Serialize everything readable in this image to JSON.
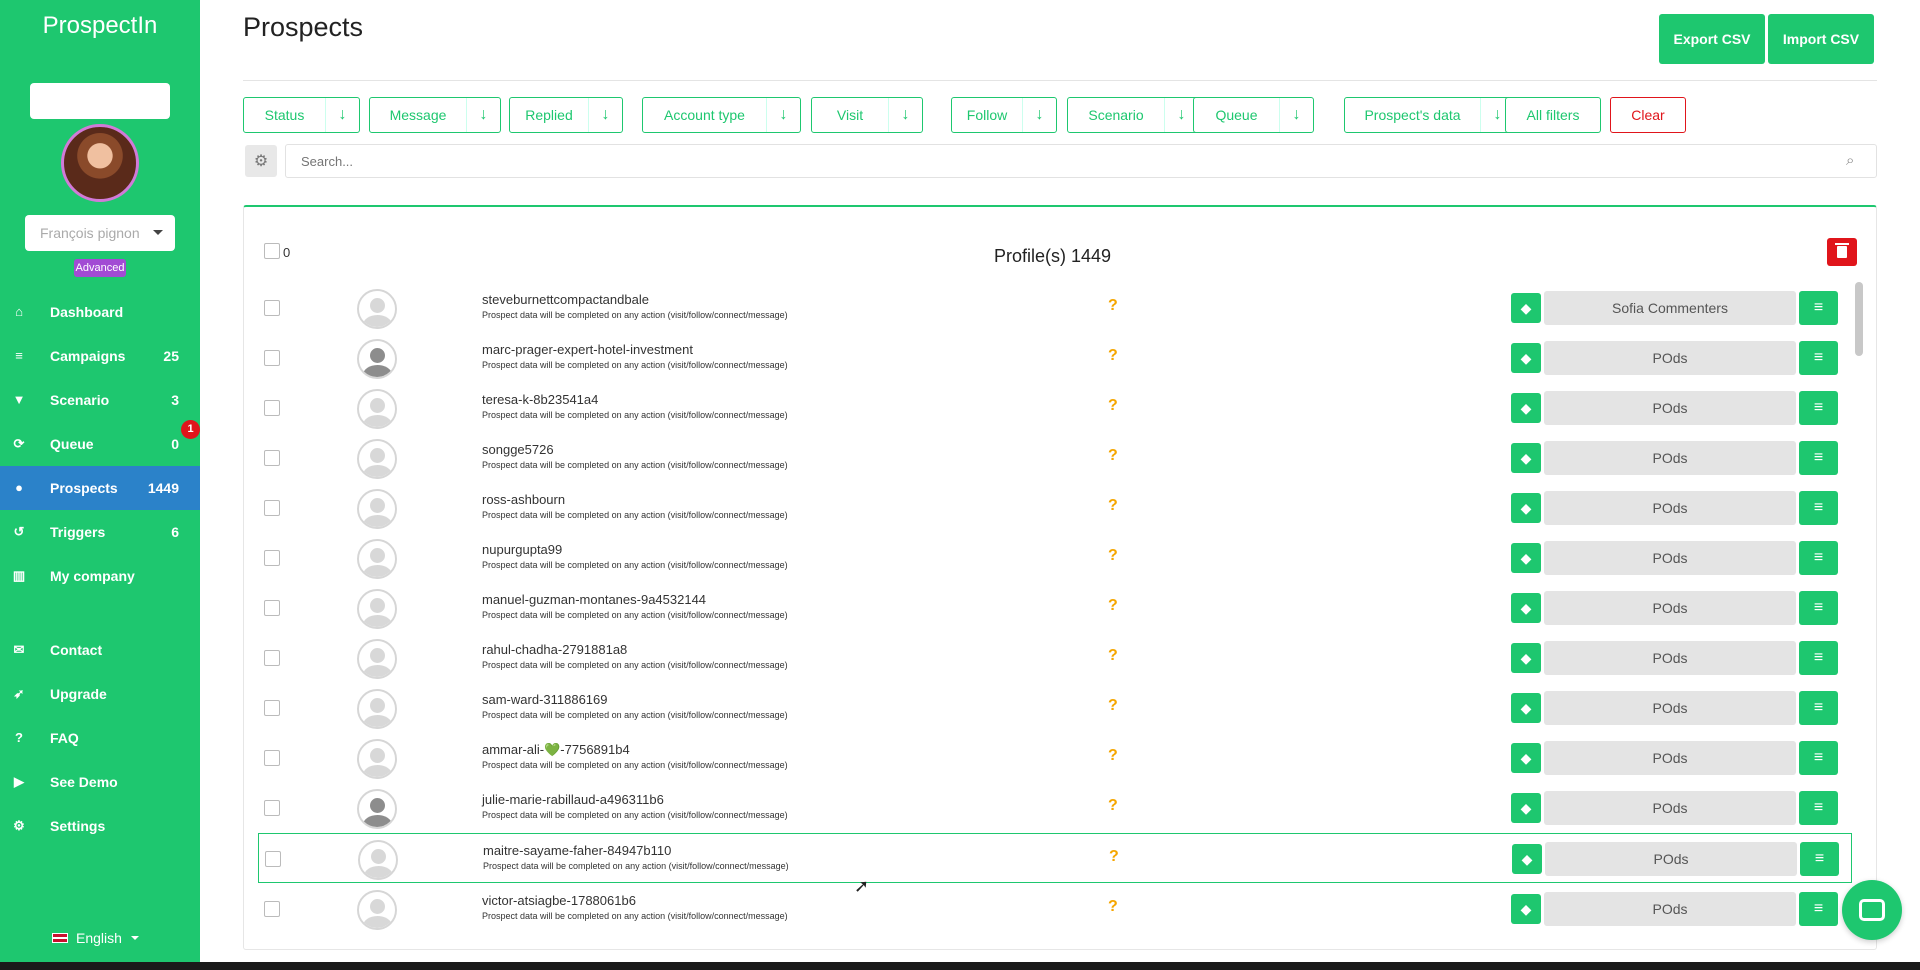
{
  "app": {
    "brand": "ProspectIn"
  },
  "user": {
    "name": "François pignon",
    "plan": "Advanced"
  },
  "sidebar": {
    "items": [
      {
        "label": "Dashboard",
        "count": "",
        "icon": "home-icon",
        "glyph": "⌂"
      },
      {
        "label": "Campaigns",
        "count": "25",
        "icon": "list-icon",
        "glyph": "≡"
      },
      {
        "label": "Scenario",
        "count": "3",
        "icon": "filter-icon",
        "glyph": "▼"
      },
      {
        "label": "Queue",
        "count": "0",
        "icon": "refresh-icon",
        "glyph": "⟳",
        "badge": "1"
      },
      {
        "label": "Prospects",
        "count": "1449",
        "icon": "user-icon",
        "glyph": "●",
        "active": true
      },
      {
        "label": "Triggers",
        "count": "6",
        "icon": "history-icon",
        "glyph": "↺"
      },
      {
        "label": "My company",
        "count": "",
        "icon": "building-icon",
        "glyph": "▥"
      },
      {
        "label": "Contact",
        "count": "",
        "icon": "envelope-icon",
        "glyph": "✉"
      },
      {
        "label": "Upgrade",
        "count": "",
        "icon": "rocket-icon",
        "glyph": "➶"
      },
      {
        "label": "FAQ",
        "count": "",
        "icon": "question-icon",
        "glyph": "?"
      },
      {
        "label": "See Demo",
        "count": "",
        "icon": "youtube-icon",
        "glyph": "▶"
      },
      {
        "label": "Settings",
        "count": "",
        "icon": "gear-icon",
        "glyph": "⚙"
      }
    ],
    "language": "English"
  },
  "header": {
    "title": "Prospects",
    "export_label": "Export CSV",
    "import_label": "Import CSV"
  },
  "filters": [
    {
      "label": "Status",
      "dropdown": true
    },
    {
      "label": "Message",
      "dropdown": true
    },
    {
      "label": "Replied",
      "dropdown": true
    },
    {
      "label": "Account type",
      "dropdown": true
    },
    {
      "label": "Visit",
      "dropdown": true
    },
    {
      "label": "Follow",
      "dropdown": true
    },
    {
      "label": "Scenario",
      "dropdown": true
    },
    {
      "label": "Queue",
      "dropdown": true
    },
    {
      "label": "Prospect's data",
      "dropdown": true
    },
    {
      "label": "All filters",
      "dropdown": false
    },
    {
      "label": "Clear",
      "dropdown": false,
      "danger": true
    }
  ],
  "search": {
    "placeholder": "Search..."
  },
  "list": {
    "selected_count": "0",
    "title": "Profile(s) 1449",
    "subtext": "Prospect data will be completed on any action (visit/follow/connect/message)",
    "status_symbol": "?",
    "rows": [
      {
        "name": "steveburnettcompactandbale",
        "campaign": "Sofia Commenters",
        "avatar": "placeholder"
      },
      {
        "name": "marc-prager-expert-hotel-investment",
        "campaign": "POds",
        "avatar": "dark"
      },
      {
        "name": "teresa-k-8b23541a4",
        "campaign": "POds",
        "avatar": "placeholder"
      },
      {
        "name": "songge5726",
        "campaign": "POds",
        "avatar": "placeholder"
      },
      {
        "name": "ross-ashbourn",
        "campaign": "POds",
        "avatar": "placeholder"
      },
      {
        "name": "nupurgupta99",
        "campaign": "POds",
        "avatar": "placeholder"
      },
      {
        "name": "manuel-guzman-montanes-9a4532144",
        "campaign": "POds",
        "avatar": "placeholder"
      },
      {
        "name": "rahul-chadha-2791881a8",
        "campaign": "POds",
        "avatar": "placeholder"
      },
      {
        "name": "sam-ward-311886169",
        "campaign": "POds",
        "avatar": "placeholder"
      },
      {
        "name": "ammar-ali-💚-7756891b4",
        "campaign": "POds",
        "avatar": "placeholder"
      },
      {
        "name": "julie-marie-rabillaud-a496311b6",
        "campaign": "POds",
        "avatar": "dark"
      },
      {
        "name": "maitre-sayame-faher-84947b110",
        "campaign": "POds",
        "avatar": "placeholder",
        "highlighted": true
      },
      {
        "name": "victor-atsiagbe-1788061b6",
        "campaign": "POds",
        "avatar": "placeholder"
      }
    ]
  },
  "colors": {
    "brand_green": "#1ec76f",
    "active_blue": "#2b82c9",
    "danger_red": "#e0151b",
    "status_orange": "#f5a600",
    "plan_purple": "#a24bd4"
  }
}
